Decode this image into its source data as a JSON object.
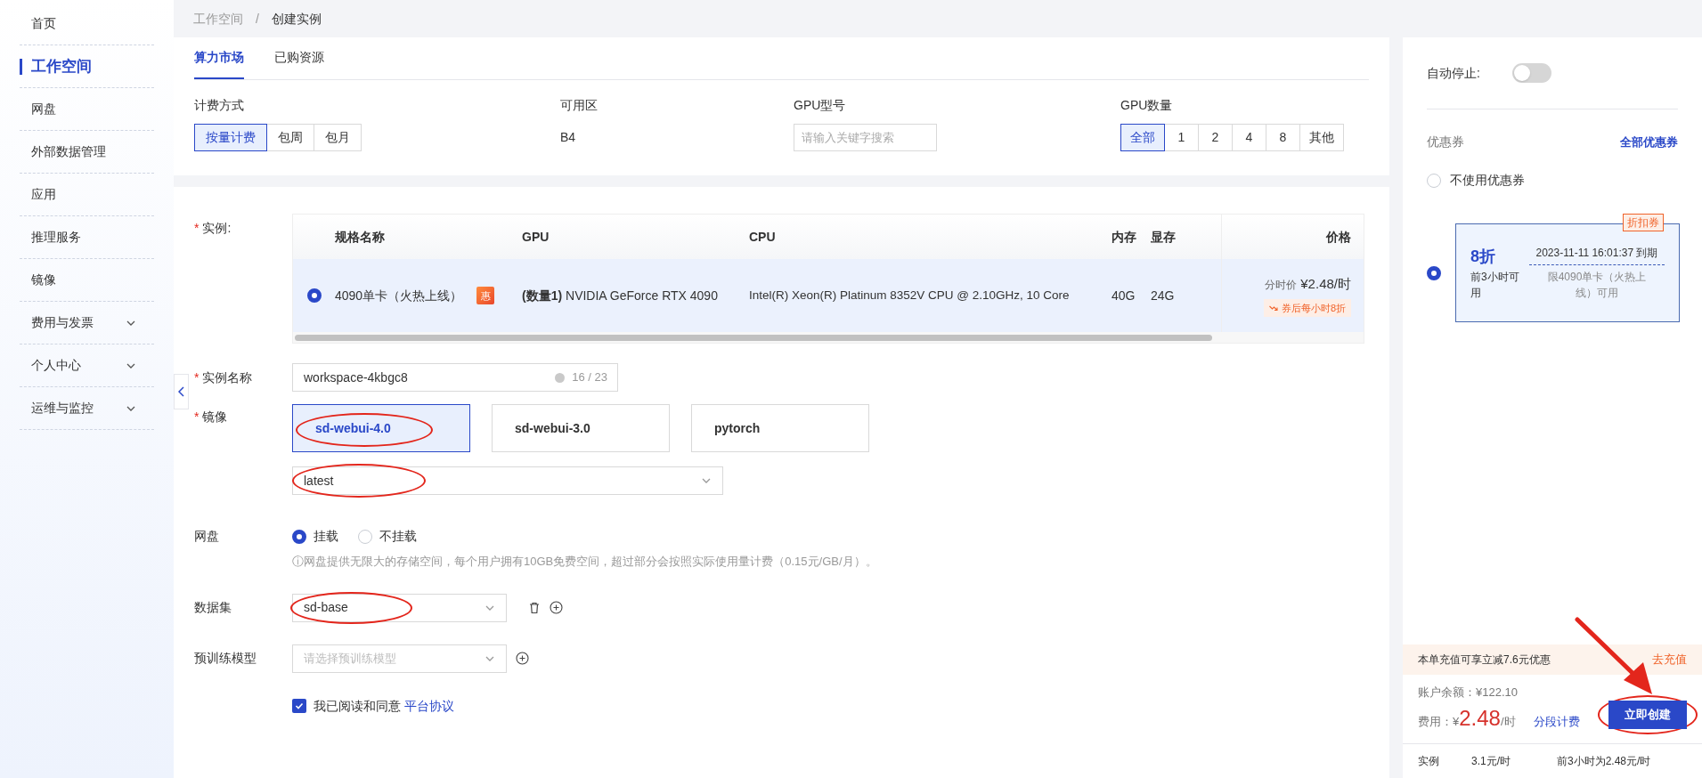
{
  "sidebar": {
    "items": [
      {
        "label": "首页",
        "selected": false,
        "expandable": false
      },
      {
        "label": "工作空间",
        "selected": true,
        "expandable": false
      },
      {
        "label": "网盘",
        "selected": false,
        "expandable": false
      },
      {
        "label": "外部数据管理",
        "selected": false,
        "expandable": false
      },
      {
        "label": "应用",
        "selected": false,
        "expandable": false
      },
      {
        "label": "推理服务",
        "selected": false,
        "expandable": false
      },
      {
        "label": "镜像",
        "selected": false,
        "expandable": false
      },
      {
        "label": "费用与发票",
        "selected": false,
        "expandable": true
      },
      {
        "label": "个人中心",
        "selected": false,
        "expandable": true
      },
      {
        "label": "运维与监控",
        "selected": false,
        "expandable": true
      }
    ]
  },
  "breadcrumb": [
    "工作空间",
    "创建实例"
  ],
  "breadcrumb_separator": "/",
  "tabs": [
    {
      "label": "算力市场",
      "selected": true
    },
    {
      "label": "已购资源",
      "selected": false
    }
  ],
  "filters": {
    "billing": {
      "label": "计费方式",
      "options": [
        {
          "label": "按量计费",
          "selected": true
        },
        {
          "label": "包周",
          "selected": false
        },
        {
          "label": "包月",
          "selected": false
        }
      ]
    },
    "zone": {
      "label": "可用区",
      "value": "B4"
    },
    "gpu_model": {
      "label": "GPU型号",
      "placeholder": "请输入关键字搜索"
    },
    "gpu_count": {
      "label": "GPU数量",
      "options": [
        {
          "label": "全部",
          "selected": true
        },
        {
          "label": "1",
          "selected": false
        },
        {
          "label": "2",
          "selected": false
        },
        {
          "label": "4",
          "selected": false
        },
        {
          "label": "8",
          "selected": false
        },
        {
          "label": "其他",
          "selected": false
        }
      ]
    }
  },
  "instance": {
    "required_mark": "*",
    "label": "实例:",
    "columns": [
      "规格名称",
      "GPU",
      "CPU",
      "内存",
      "显存",
      "价格"
    ],
    "rows": [
      {
        "selected": true,
        "name": "4090单卡（火热上线）",
        "badge": "惠",
        "gpu_count": "(数量1)",
        "gpu": "NVIDIA GeForce RTX 4090",
        "cpu": "Intel(R) Xeon(R) Platinum 8352V CPU @ 2.10GHz, 10 Core",
        "memory": "40G",
        "vram": "24G",
        "price_label": "分时价",
        "price": "¥2.48/时",
        "promo": "券后每小时8折"
      }
    ]
  },
  "form": {
    "name": {
      "required_mark": "*",
      "label": "实例名称",
      "value": "workspace-4kbgc8",
      "counter": "16 / 23"
    },
    "image": {
      "required_mark": "*",
      "label": "镜像",
      "options": [
        {
          "label": "sd-webui-4.0",
          "selected": true
        },
        {
          "label": "sd-webui-3.0",
          "selected": false
        },
        {
          "label": "pytorch",
          "selected": false
        }
      ],
      "version": "latest"
    },
    "disk": {
      "label": "网盘",
      "options": [
        {
          "label": "挂载",
          "selected": true
        },
        {
          "label": "不挂载",
          "selected": false
        }
      ],
      "hint": "ⓘ网盘提供无限大的存储空间，每个用户拥有10GB免费空间，超过部分会按照实际使用量计费（0.15元/GB/月）。"
    },
    "dataset": {
      "label": "数据集",
      "value": "sd-base"
    },
    "pretrained": {
      "label": "预训练模型",
      "placeholder": "请选择预训练模型"
    },
    "agreement": {
      "checked": true,
      "text": "我已阅读和同意",
      "link": "平台协议"
    }
  },
  "panel": {
    "auto_stop": {
      "label": "自动停止:",
      "on": false
    },
    "coupons": {
      "title": "优惠券",
      "all_link": "全部优惠券",
      "none_option": {
        "label": "不使用优惠券",
        "selected": false
      },
      "items": [
        {
          "selected": true,
          "tag": "折扣券",
          "discount": "8折",
          "condition": "前3小时可用",
          "expiry": "2023-11-11 16:01:37 到期",
          "scope": "限4090单卡（火热上线）可用"
        }
      ]
    },
    "recharge": {
      "text": "本单充值可享立减7.6元优惠",
      "link": "去充值"
    },
    "balance": "账户余额：¥122.10",
    "cost_label": "费用：¥",
    "cost": "2.48",
    "cost_unit": "/时",
    "segment_link": "分段计费",
    "create_button": "立即创建",
    "breakdown": [
      {
        "item": "实例",
        "price": "3.1元/时",
        "note": "前3小时为2.48元/时"
      }
    ]
  }
}
